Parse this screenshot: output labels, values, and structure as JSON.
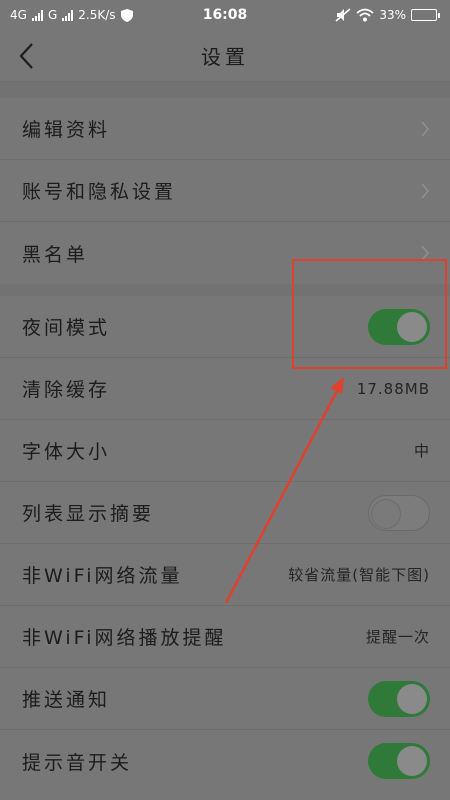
{
  "status_bar": {
    "net1": "4G",
    "net2": "G",
    "speed": "2.5K/s",
    "time": "16:08",
    "battery": "33%",
    "battery_level": 0.33
  },
  "header": {
    "title": "设置"
  },
  "group1": [
    {
      "label": "编辑资料"
    },
    {
      "label": "账号和隐私设置"
    },
    {
      "label": "黑名单"
    }
  ],
  "group2": {
    "night_mode": {
      "label": "夜间模式",
      "on": true
    },
    "clear_cache": {
      "label": "清除缓存",
      "value": "17.88MB"
    },
    "font_size": {
      "label": "字体大小",
      "value": "中"
    },
    "list_summary": {
      "label": "列表显示摘要",
      "on": false
    },
    "non_wifi_traffic": {
      "label": "非WiFi网络流量",
      "value": "较省流量(智能下图)"
    },
    "non_wifi_play": {
      "label": "非WiFi网络播放提醒",
      "value": "提醒一次"
    },
    "push": {
      "label": "推送通知",
      "on": true
    },
    "sound": {
      "label": "提示音开关",
      "on": true
    }
  },
  "colors": {
    "toggle_on": "#2f7a38",
    "annotation": "#e0402e"
  }
}
